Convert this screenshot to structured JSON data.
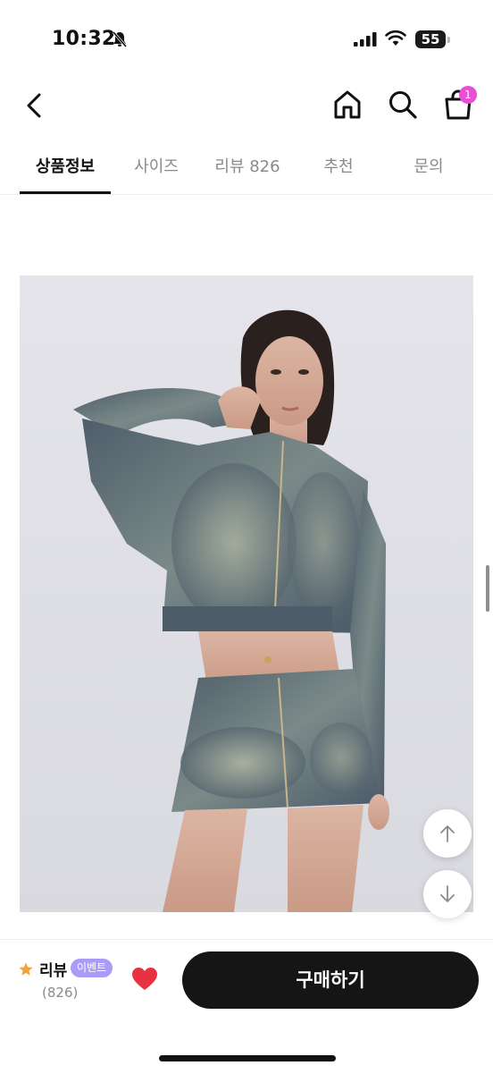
{
  "status_bar": {
    "time": "10:32",
    "battery": "55"
  },
  "nav": {
    "cart_badge": "1"
  },
  "tabs": [
    {
      "label": "상품정보"
    },
    {
      "label": "사이즈"
    },
    {
      "label": "리뷰 826"
    },
    {
      "label": "추천"
    },
    {
      "label": "문의"
    }
  ],
  "bottom_bar": {
    "review_label": "리뷰",
    "event_badge": "이벤트",
    "review_count": "(826)",
    "buy_label": "구매하기"
  },
  "colors": {
    "accent_pink": "#e94ed4",
    "event_purple": "#a99cf6",
    "heart_red": "#e8323f",
    "star_orange": "#f2a13b"
  }
}
